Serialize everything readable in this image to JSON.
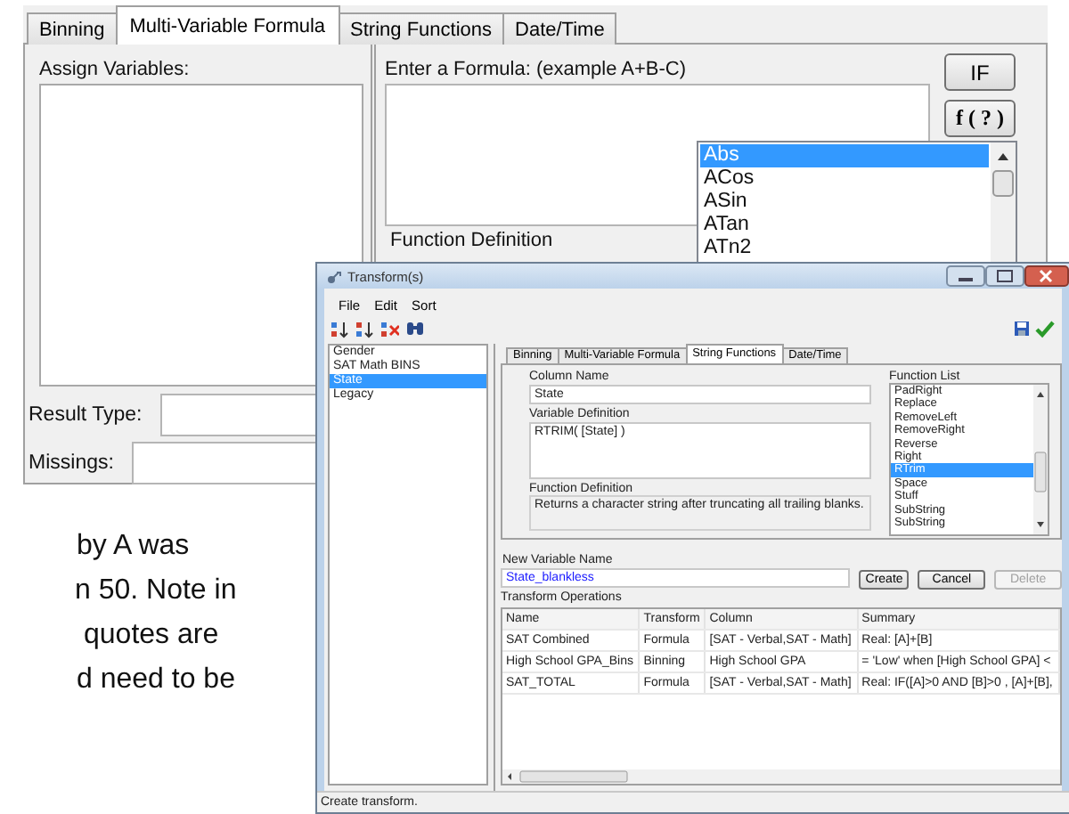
{
  "dialog": {
    "tabs": [
      {
        "label": "Binning",
        "selected": false
      },
      {
        "label": "Multi-Variable Formula",
        "selected": true
      },
      {
        "label": "String Functions",
        "selected": false
      },
      {
        "label": "Date/Time",
        "selected": false
      }
    ],
    "assign_label": "Assign Variables:",
    "result_type_label": "Result Type:",
    "missings_label": "Missings:",
    "formula_label": "Enter a Formula: (example A+B-C)",
    "if_button": "IF",
    "function_button": "f ( ? )",
    "function_list": [
      {
        "label": "Abs",
        "selected": true
      },
      {
        "label": "ACos",
        "selected": false
      },
      {
        "label": "ASin",
        "selected": false
      },
      {
        "label": "ATan",
        "selected": false
      },
      {
        "label": "ATn2",
        "selected": false
      }
    ],
    "function_definition_label": "Function Definition"
  },
  "slide_text": [
    "by A was",
    "n 50. Note in",
    "quotes are",
    "d need to be"
  ],
  "transform_window": {
    "title": "Transform(s)",
    "menu": [
      "File",
      "Edit",
      "Sort"
    ],
    "variables": [
      {
        "label": "Gender",
        "selected": false
      },
      {
        "label": "SAT Math BINS",
        "selected": false
      },
      {
        "label": "State",
        "selected": true
      },
      {
        "label": "Legacy",
        "selected": false
      }
    ],
    "tabs": [
      {
        "label": "Binning",
        "selected": false
      },
      {
        "label": "Multi-Variable Formula",
        "selected": false
      },
      {
        "label": "String Functions",
        "selected": true
      },
      {
        "label": "Date/Time",
        "selected": false
      }
    ],
    "column_name_label": "Column Name",
    "column_name": "State",
    "variable_definition_label": "Variable Definition",
    "variable_definition": "RTRIM( [State] )",
    "function_definition_label": "Function Definition",
    "function_definition": "Returns a character string after truncating all trailing blanks.",
    "function_list_label": "Function List",
    "function_list": [
      {
        "label": "PadRight",
        "selected": false
      },
      {
        "label": "Replace",
        "selected": false
      },
      {
        "label": "RemoveLeft",
        "selected": false
      },
      {
        "label": "RemoveRight",
        "selected": false
      },
      {
        "label": "Reverse",
        "selected": false
      },
      {
        "label": "Right",
        "selected": false
      },
      {
        "label": "RTrim",
        "selected": true
      },
      {
        "label": "Space",
        "selected": false
      },
      {
        "label": "Stuff",
        "selected": false
      },
      {
        "label": "SubString",
        "selected": false
      },
      {
        "label": "SubString",
        "selected": false
      }
    ],
    "new_variable_label": "New Variable Name",
    "new_variable": "State_blankless",
    "buttons": [
      {
        "label": "Create",
        "disabled": false
      },
      {
        "label": "Cancel",
        "disabled": false
      },
      {
        "label": "Delete",
        "disabled": true
      }
    ],
    "operations_label": "Transform Operations",
    "table": {
      "columns": [
        "Name",
        "Transform",
        "Column",
        "Summary"
      ],
      "rows": [
        [
          "SAT Combined",
          "Formula",
          "[SAT - Verbal,SAT - Math]",
          "Real: [A]+[B]"
        ],
        [
          "High School GPA_Bins",
          "Binning",
          "High School GPA",
          "= 'Low' when [High School GPA] <"
        ],
        [
          "SAT_TOTAL",
          "Formula",
          "[SAT - Verbal,SAT - Math]",
          "Real: IF([A]>0 AND [B]>0 , [A]+[B],"
        ]
      ]
    },
    "status": "Create transform."
  }
}
